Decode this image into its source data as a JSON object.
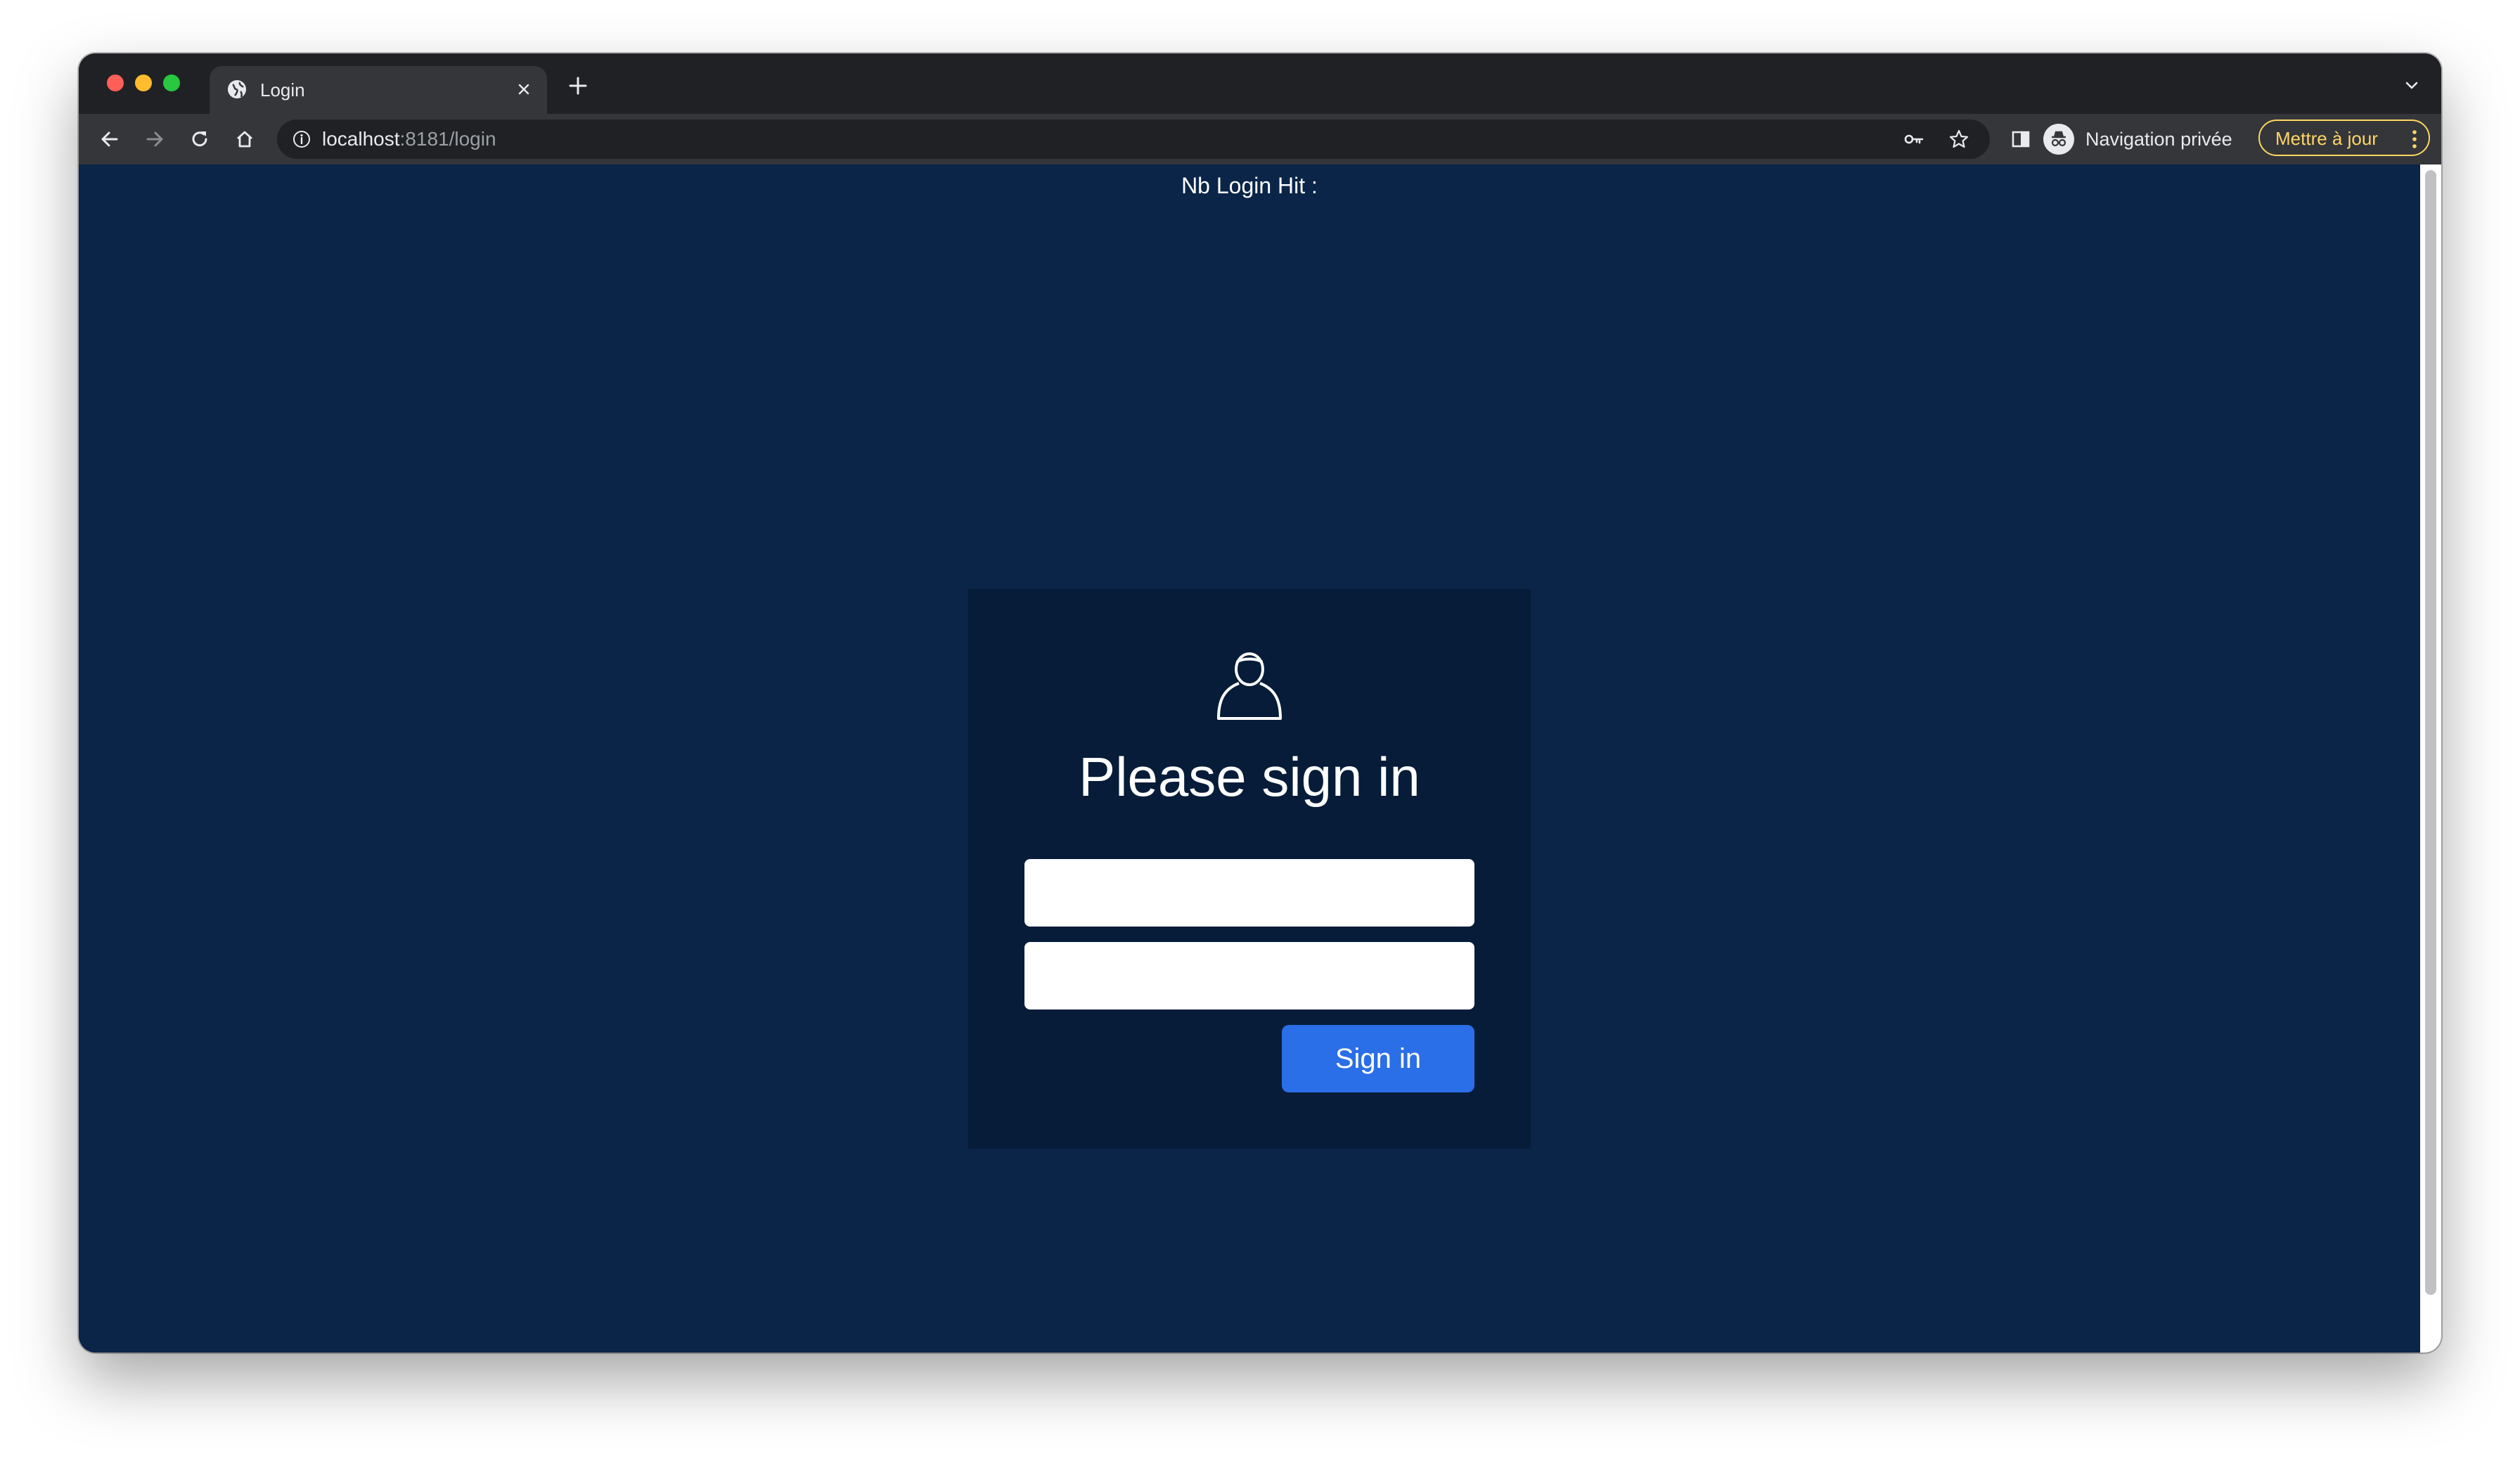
{
  "browser": {
    "tab": {
      "title": "Login",
      "favicon": "globe-icon"
    },
    "address": {
      "host": "localhost",
      "rest": ":8181/login"
    },
    "profile": {
      "label": "Navigation privée",
      "icon": "incognito-icon"
    },
    "update_button": {
      "label": "Mettre à jour"
    },
    "colors": {
      "frame": "#202124",
      "toolbar": "#35363a",
      "update_accent": "#fdd663"
    }
  },
  "page": {
    "hit_counter": "Nb Login Hit :",
    "login": {
      "icon": "user-icon",
      "title": "Please sign in",
      "username_value": "",
      "password_value": "",
      "submit_label": "Sign in"
    },
    "colors": {
      "background": "#0a2548",
      "card": "#061c38",
      "button": "#2a6ee8"
    }
  }
}
